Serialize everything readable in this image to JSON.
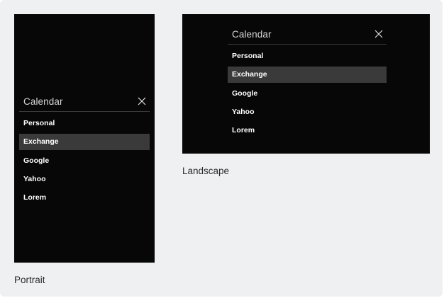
{
  "portrait": {
    "menu_title": "Calendar",
    "items": [
      "Personal",
      "Exchange",
      "Google",
      "Yahoo",
      "Lorem"
    ],
    "selected_index": 1,
    "caption": "Portrait"
  },
  "landscape": {
    "menu_title": "Calendar",
    "items": [
      "Personal",
      "Exchange",
      "Google",
      "Yahoo",
      "Lorem"
    ],
    "selected_index": 1,
    "caption": "Landscape"
  },
  "icons": {
    "close": "close-icon"
  },
  "colors": {
    "screen_bg": "#070707",
    "selected_bg": "#3a3a3a",
    "page_bg": "#eff0f2"
  }
}
